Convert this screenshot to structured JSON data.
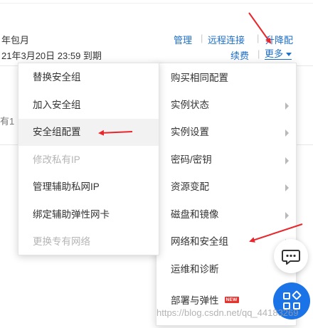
{
  "background": {
    "billing_text": "年包月",
    "expiry_text": "21年3月20日 23:59 到期",
    "row_text": "有1"
  },
  "actions": {
    "manage": "管理",
    "remote_connect": "远程连接",
    "upgrade_downgrade": "升降配",
    "renew": "续费",
    "more": "更多"
  },
  "left_menu": {
    "items": [
      {
        "label": "替换安全组",
        "disabled": false
      },
      {
        "label": "加入安全组",
        "disabled": false
      },
      {
        "label": "安全组配置",
        "disabled": false,
        "highlighted": true
      },
      {
        "label": "修改私有IP",
        "disabled": true
      },
      {
        "label": "管理辅助私网IP",
        "disabled": false
      },
      {
        "label": "绑定辅助弹性网卡",
        "disabled": false
      },
      {
        "label": "更换专有网络",
        "disabled": true
      }
    ]
  },
  "right_menu": {
    "items": [
      {
        "label": "购买相同配置",
        "has_submenu": false
      },
      {
        "label": "实例状态",
        "has_submenu": true
      },
      {
        "label": "实例设置",
        "has_submenu": true
      },
      {
        "label": "密码/密钥",
        "has_submenu": true
      },
      {
        "label": "资源变配",
        "has_submenu": true
      },
      {
        "label": "磁盘和镜像",
        "has_submenu": true
      },
      {
        "label": "网络和安全组",
        "has_submenu": true
      },
      {
        "label": "运维和诊断",
        "has_submenu": false
      },
      {
        "label": "部署与弹性",
        "has_submenu": false,
        "badge": "NEW"
      }
    ]
  },
  "watermark": "https://blog.csdn.net/qq_44183269",
  "colors": {
    "link": "#1e6fc7",
    "arrow": "#e8262b",
    "fab": "#1b73e8",
    "badge": "#e7322d"
  },
  "icons": {
    "chat": "chat-bubble-icon",
    "apps": "grid-apps-icon",
    "submenu": "chevron-right-icon"
  }
}
